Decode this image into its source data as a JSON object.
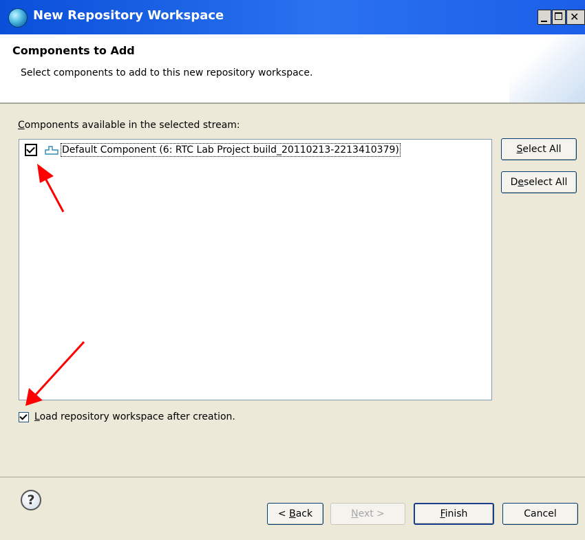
{
  "window": {
    "title": "New Repository Workspace",
    "controls": {
      "minimize": "minimize-icon",
      "maximize": "maximize-icon",
      "close": "close-icon"
    }
  },
  "header": {
    "title": "Components to Add",
    "description": "Select components to add to this new repository workspace."
  },
  "components": {
    "label_first": "C",
    "label_rest": "omponents available in the selected stream:",
    "items": [
      {
        "label": "Default Component (6: RTC Lab Project build_20110213-2213410379)",
        "checked": true,
        "icon": "component-icon"
      }
    ]
  },
  "buttons": {
    "select_all_pre": "",
    "select_all_ul": "S",
    "select_all_post": "elect All",
    "deselect_all_pre": "D",
    "deselect_all_ul": "e",
    "deselect_all_post": "select All"
  },
  "load_option": {
    "label_first": "L",
    "label_rest": "oad repository workspace after creation.",
    "checked": true
  },
  "footer": {
    "back_pre": "< ",
    "back_ul": "B",
    "back_post": "ack",
    "next_pre": "",
    "next_ul": "N",
    "next_post": "ext >",
    "finish_ul": "F",
    "finish_post": "inish",
    "cancel": "Cancel",
    "help_icon": "help-icon",
    "help_glyph": "?"
  },
  "colors": {
    "titlebar": "#0a4fd8",
    "annotation_arrow": "#ff0000",
    "dialog_bg": "#ece9d8"
  }
}
